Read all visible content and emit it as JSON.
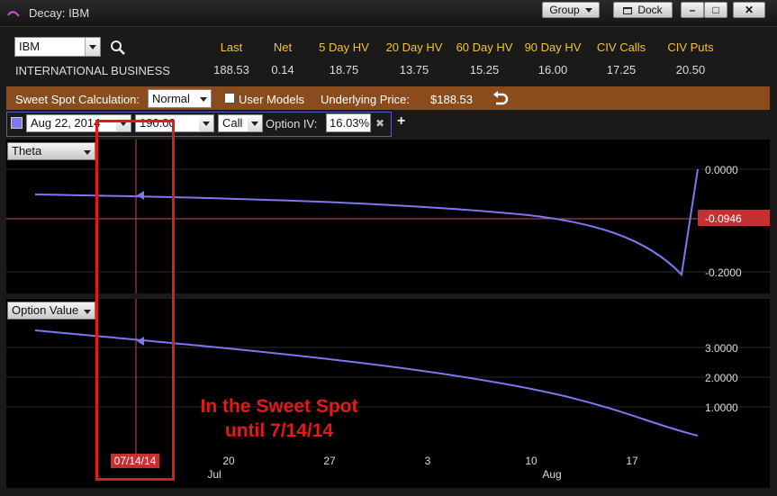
{
  "window": {
    "title": "Decay: IBM",
    "group_label": "Group",
    "dock_label": "Dock",
    "minimize_label": "–",
    "maximize_label": "□",
    "close_label": "✕"
  },
  "symbol": {
    "ticker": "IBM",
    "company": "INTERNATIONAL BUSINESS"
  },
  "quote": {
    "headers": [
      "Last",
      "Net",
      "5 Day HV",
      "20 Day HV",
      "60 Day HV",
      "90 Day HV",
      "CIV Calls",
      "CIV Puts"
    ],
    "values": [
      "188.53",
      "0.14",
      "18.75",
      "13.75",
      "15.25",
      "16.00",
      "17.25",
      "20.50"
    ]
  },
  "sweet_spot": {
    "calc_label": "Sweet Spot Calculation:",
    "calc_value": "Normal",
    "user_models_label": "User Models",
    "underlying_label": "Underlying Price:",
    "underlying_value": "$188.53"
  },
  "option": {
    "expiry": "Aug 22, 2014",
    "strike": "190.00",
    "type": "Call",
    "iv_label": "Option IV:",
    "iv_value": "16.03%"
  },
  "theta_panel": {
    "selector": "Theta",
    "ticks": [
      "0.0000",
      "-0.2000"
    ],
    "current_value": "-0.0946"
  },
  "value_panel": {
    "selector": "Option Value",
    "ticks": [
      "3.0000",
      "2.0000",
      "1.0000"
    ]
  },
  "x_axis": {
    "cursor_date": "07/14/14",
    "ticks": [
      "20",
      "27",
      "3",
      "10",
      "17"
    ],
    "months": [
      "Jul",
      "Aug"
    ]
  },
  "annotation": {
    "line1": "In the Sweet Spot",
    "line2": "until 7/14/14"
  },
  "colors": {
    "series": "#7b78f0",
    "highlight": "#e11a1a",
    "bar": "#8a4c1c",
    "quote_header": "#f2c233"
  }
}
